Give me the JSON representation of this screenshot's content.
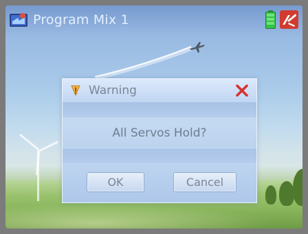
{
  "status_bar": {
    "title": "Program Mix 1",
    "icons": [
      "app-icon",
      "battery-icon",
      "transmitter-icon"
    ]
  },
  "dialog": {
    "title": "Warning",
    "message": "All Servos Hold?",
    "ok_label": "OK",
    "cancel_label": "Cancel",
    "icons": [
      "warning-icon",
      "close-icon"
    ]
  },
  "colors": {
    "close": "#d6332d",
    "battery": "#36c24a",
    "status_text": "#e4efff",
    "dialog_text": "#6f7d8f"
  }
}
